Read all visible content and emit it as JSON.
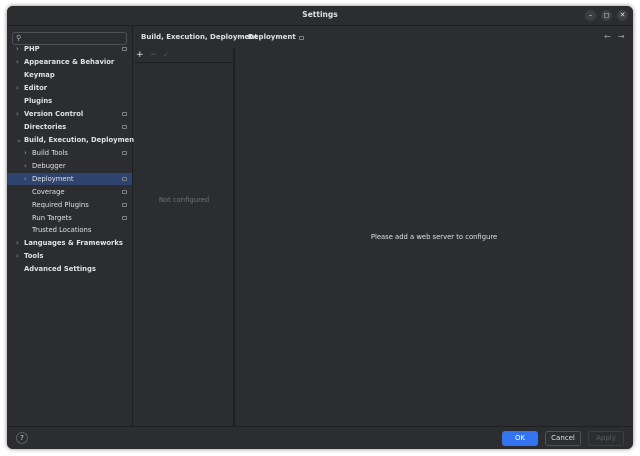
{
  "window": {
    "title": "Settings",
    "controls": [
      "–",
      "◻",
      "✕"
    ]
  },
  "search": {
    "placeholder": ""
  },
  "sidebar": {
    "items": [
      {
        "label": "PHP",
        "expander": "›",
        "marker": true
      },
      {
        "label": "Appearance & Behavior",
        "expander": "›",
        "marker": false
      },
      {
        "label": "Keymap",
        "expander": "",
        "marker": false
      },
      {
        "label": "Editor",
        "expander": "›",
        "marker": false
      },
      {
        "label": "Plugins",
        "expander": "",
        "marker": false
      },
      {
        "label": "Version Control",
        "expander": "›",
        "marker": true
      },
      {
        "label": "Directories",
        "expander": "",
        "marker": true
      },
      {
        "label": "Build, Execution, Deployment",
        "expander": "⌄",
        "marker": false
      },
      {
        "label": "Build Tools",
        "expander": "›",
        "marker": true
      },
      {
        "label": "Debugger",
        "expander": "›",
        "marker": false
      },
      {
        "label": "Deployment",
        "expander": "›",
        "marker": true,
        "selected": true
      },
      {
        "label": "Coverage",
        "expander": "",
        "marker": true
      },
      {
        "label": "Required Plugins",
        "expander": "",
        "marker": true
      },
      {
        "label": "Run Targets",
        "expander": "",
        "marker": true
      },
      {
        "label": "Trusted Locations",
        "expander": "",
        "marker": false
      },
      {
        "label": "Languages & Frameworks",
        "expander": "›",
        "marker": false
      },
      {
        "label": "Tools",
        "expander": "›",
        "marker": false
      },
      {
        "label": "Advanced Settings",
        "expander": "",
        "marker": false
      }
    ]
  },
  "breadcrumb": {
    "parent": "Build, Execution, Deployment",
    "separator": "›",
    "current": "Deployment"
  },
  "nav": {
    "back": "←",
    "forward": "→"
  },
  "servers": {
    "toolbar": {
      "add": "+",
      "remove": "−",
      "check": "✓"
    },
    "empty_text": "Not configured"
  },
  "content": {
    "hint": "Please add a web server to configure"
  },
  "footer": {
    "help": "?",
    "ok": "OK",
    "cancel": "Cancel",
    "apply": "Apply"
  },
  "colors": {
    "accent": "#3574f0",
    "selection": "#2e436e",
    "background": "#2b2d30",
    "panel": "#1e1f22"
  }
}
